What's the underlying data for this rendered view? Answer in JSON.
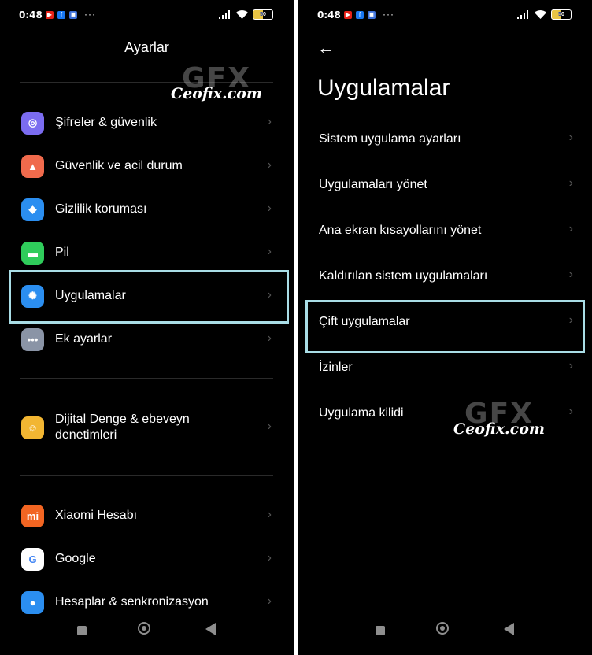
{
  "status": {
    "time": "0:48",
    "battery": "50",
    "dots": "···"
  },
  "left": {
    "title": "Ayarlar",
    "groups": [
      [
        {
          "label": "Şifreler & güvenlik",
          "icon": "fingerprint-icon",
          "color": "#7b6cf0"
        },
        {
          "label": "Güvenlik ve acil durum",
          "icon": "emergency-icon",
          "color": "#f06a4c"
        },
        {
          "label": "Gizlilik koruması",
          "icon": "privacy-shield-icon",
          "color": "#2b8ef0"
        },
        {
          "label": "Pil",
          "icon": "battery-icon",
          "color": "#2fcc5b"
        },
        {
          "label": "Uygulamalar",
          "icon": "gear-icon",
          "color": "#2b8ef0"
        },
        {
          "label": "Ek ayarlar",
          "icon": "more-dots-icon",
          "color": "#8a94a6"
        }
      ],
      [
        {
          "label": "Dijital Denge & ebeveyn denetimleri",
          "icon": "digital-wellbeing-icon",
          "color": "#f2b632"
        }
      ],
      [
        {
          "label": "Xiaomi Hesabı",
          "icon": "xiaomi-icon",
          "color": "#f26522"
        },
        {
          "label": "Google",
          "icon": "google-icon",
          "color": "#ffffff"
        },
        {
          "label": "Hesaplar & senkronizasyon",
          "icon": "account-icon",
          "color": "#2b8ef0"
        }
      ]
    ]
  },
  "right": {
    "title": "Uygulamalar",
    "items": [
      {
        "label": "Sistem uygulama ayarları"
      },
      {
        "label": "Uygulamaları yönet"
      },
      {
        "label": "Ana ekran kısayollarını yönet"
      },
      {
        "label": "Kaldırılan sistem uygulamaları"
      },
      {
        "label": "Çift uygulamalar"
      },
      {
        "label": "İzinler"
      },
      {
        "label": "Uygulama kilidi"
      }
    ]
  },
  "watermark": {
    "logo": "GFX",
    "text": "Ceofix.com"
  },
  "chevron": "›",
  "back": "←"
}
